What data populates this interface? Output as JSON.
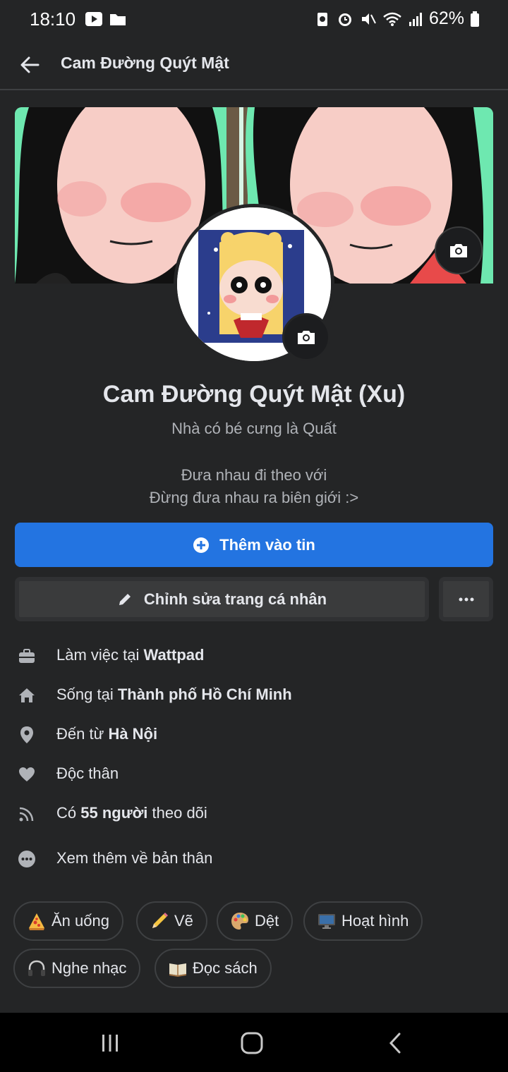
{
  "status_bar": {
    "time": "18:10",
    "battery": "62%"
  },
  "header": {
    "title": "Cam Đường Quýt Mật"
  },
  "profile": {
    "name": "Cam Đường Quýt Mật (Xu)",
    "nickname": "Nhà có bé cưng là Quất",
    "bio_line1": "Đưa nhau đi theo với",
    "bio_line2": "Đừng đưa nhau ra biên giới :>"
  },
  "actions": {
    "add_story": "Thêm vào tin",
    "edit_profile": "Chỉnh sửa trang cá nhân",
    "more": "···"
  },
  "details": {
    "work_prefix": "Làm việc tại ",
    "work_place": "Wattpad",
    "lives_prefix": "Sống tại ",
    "lives_place": "Thành phố Hồ Chí Minh",
    "from_prefix": "Đến từ ",
    "from_place": "Hà Nội",
    "relationship": "Độc thân",
    "followers_prefix": "Có ",
    "followers_count": "55 người",
    "followers_suffix": " theo dõi",
    "see_more": "Xem thêm về bản thân"
  },
  "hobbies": [
    {
      "emoji": "pizza-icon",
      "label": "Ăn uống"
    },
    {
      "emoji": "pencil-icon",
      "label": "Vẽ"
    },
    {
      "emoji": "palette-icon",
      "label": "Dệt"
    },
    {
      "emoji": "monitor-icon",
      "label": "Hoạt hình"
    },
    {
      "emoji": "headphones-icon",
      "label": "Nghe nhạc"
    },
    {
      "emoji": "book-icon",
      "label": "Đọc sách"
    }
  ],
  "colors": {
    "background": "#242526",
    "primary_button": "#2374e1",
    "secondary_button": "#3a3b3c",
    "text_primary": "#e4e6eb",
    "text_secondary": "#b0b3b8"
  }
}
